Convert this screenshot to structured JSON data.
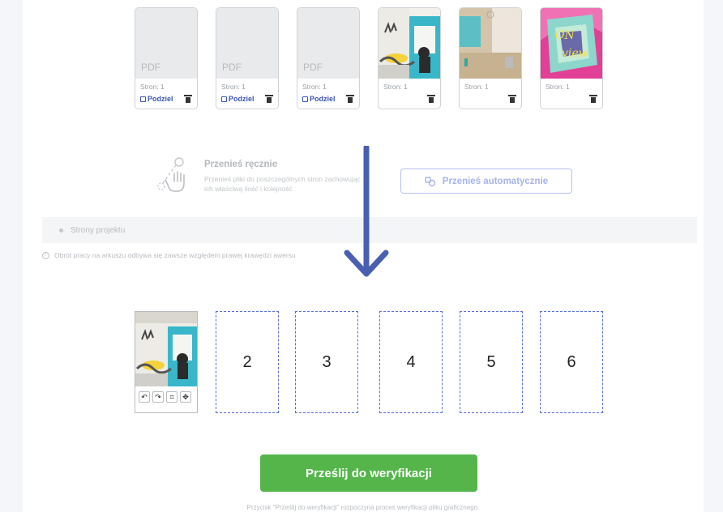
{
  "files": [
    {
      "type": "pdf",
      "thumb_label": "PDF",
      "pages_label": "Stron: 1",
      "split_label": "Podziel",
      "has_split": true
    },
    {
      "type": "pdf",
      "thumb_label": "PDF",
      "pages_label": "Stron: 1",
      "split_label": "Podziel",
      "has_split": true
    },
    {
      "type": "pdf",
      "thumb_label": "PDF",
      "pages_label": "Stron: 1",
      "split_label": "Podziel",
      "has_split": true
    },
    {
      "type": "image",
      "pages_label": "Stron: 1",
      "has_split": false
    },
    {
      "type": "image",
      "pages_label": "Stron: 1",
      "has_split": false
    },
    {
      "type": "image",
      "thumb_text_1": "ON",
      "thumb_text_2": "view",
      "pages_label": "Stron: 1",
      "has_split": false
    }
  ],
  "manual": {
    "title": "Przenieś ręcznie",
    "description": "Przenieś pliki do poszczególnych stron zachowując ich właściwą ilość i kolejność"
  },
  "auto_button": {
    "label": "Przenieś automatycznie"
  },
  "section": {
    "title": "Strony projektu"
  },
  "info": {
    "text": "Obrót pracy na arkuszu odbywa się zawsze względem prawej krawędzi awersu"
  },
  "pages": {
    "slots": [
      "2",
      "3",
      "4",
      "5",
      "6"
    ],
    "tools": [
      "↶",
      "↷",
      "⌗",
      "✥"
    ]
  },
  "submit": {
    "label": "Prześlij do weryfikacji",
    "note": "Przycisk \"Prześlij do weryfikacji\" rozpoczyna proces weryfikacji pliku graficznego."
  },
  "colors": {
    "accent_blue": "#3a55b8",
    "arrow_blue": "#4a5fb0",
    "submit_green": "#55b54b",
    "slot_border": "#5a6fd6"
  }
}
